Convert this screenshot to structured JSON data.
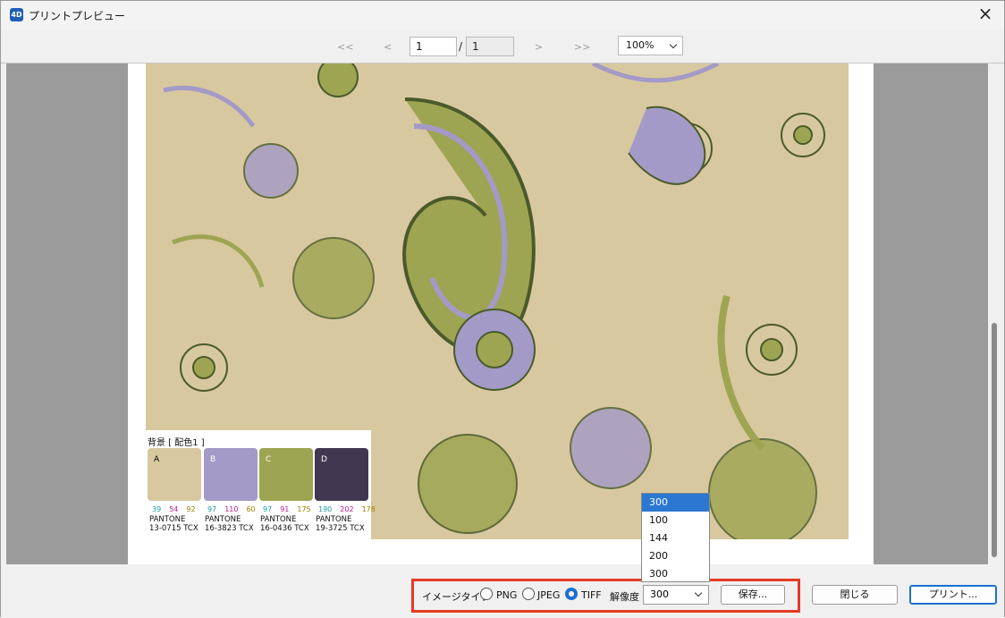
{
  "window": {
    "title": "プリントプレビュー",
    "app_icon": "4D"
  },
  "toolbar": {
    "first": "<<",
    "prev": "<",
    "next": ">",
    "last": ">>",
    "current_page": "1",
    "slash": "/",
    "total_pages": "1",
    "zoom": "100%"
  },
  "palette": {
    "title": "背景 [ 配色1 ]",
    "swatches": [
      {
        "letter": "A",
        "color": "#d8c8a0",
        "rgb": [
          "39",
          "54",
          "92"
        ],
        "pantone": "PANTONE",
        "code": "13-0715 TCX"
      },
      {
        "letter": "B",
        "color": "#a39ac7",
        "rgb": [
          "97",
          "110",
          "60"
        ],
        "pantone": "PANTONE",
        "code": "16-3823 TCX"
      },
      {
        "letter": "C",
        "color": "#9ea552",
        "rgb": [
          "97",
          "91",
          "175"
        ],
        "pantone": "PANTONE",
        "code": "16-0436 TCX"
      },
      {
        "letter": "D",
        "color": "#413751",
        "rgb": [
          "190",
          "202",
          "178"
        ],
        "pantone": "PANTONE",
        "code": "19-3725 TCX"
      }
    ]
  },
  "export": {
    "image_type_label": "イメージタイプ",
    "png": "PNG",
    "jpeg": "JPEG",
    "tiff": "TIFF",
    "selected": "TIFF",
    "resolution_label": "解像度",
    "resolution_value": "300",
    "resolution_options": [
      "300",
      "100",
      "144",
      "200",
      "300"
    ],
    "save": "保存..."
  },
  "buttons": {
    "close": "閉じる",
    "print": "プリント..."
  },
  "colors": {
    "accent": "#1a6fd1",
    "highlight": "#e53a23",
    "background": "#d8c8a0",
    "lavender": "#a39ac7",
    "olive": "#9ea552"
  }
}
